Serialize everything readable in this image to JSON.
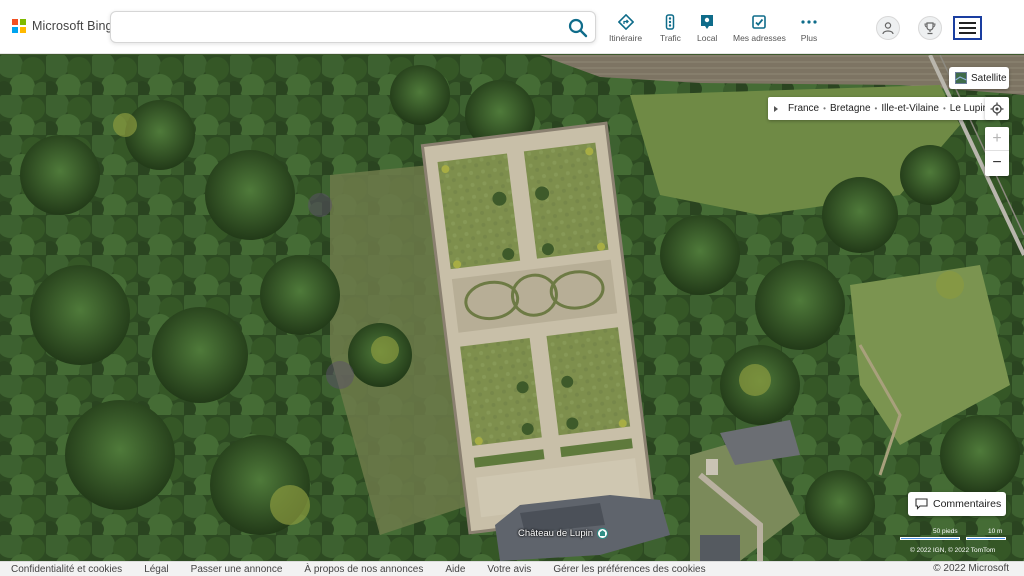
{
  "header": {
    "brand": "Microsoft Bing",
    "search": {
      "value": "",
      "placeholder": ""
    },
    "nav": [
      {
        "label": "Itinéraire",
        "icon": "directions-icon"
      },
      {
        "label": "Trafic",
        "icon": "traffic-icon"
      },
      {
        "label": "Local",
        "icon": "local-icon"
      },
      {
        "label": "Mes adresses",
        "icon": "my-places-icon"
      },
      {
        "label": "Plus",
        "icon": "more-icon"
      }
    ]
  },
  "map": {
    "view_label": "Satellite",
    "breadcrumb": [
      "France",
      "Bretagne",
      "Ille-et-Vilaine",
      "Le Lupin"
    ],
    "poi_label": "Château de Lupin",
    "feedback_label": "Commentaires",
    "scale_feet": "50 pieds",
    "scale_meters": "10 m",
    "attribution": "© 2022 IGN, © 2022 TomTom"
  },
  "footer": {
    "links": [
      "Confidentialité et cookies",
      "Légal",
      "Passer une annonce",
      "À propos de nos annonces",
      "Aide",
      "Votre avis",
      "Gérer les préférences des cookies"
    ],
    "copyright": "© 2022 Microsoft"
  },
  "colors": {
    "accent": "#0f6c8a",
    "menu_border": "#1a3ea0",
    "scale_bar": "#4a90e2",
    "ms_red": "#f25022",
    "ms_green": "#7fba00",
    "ms_blue": "#00a4ef",
    "ms_yellow": "#ffb900"
  }
}
